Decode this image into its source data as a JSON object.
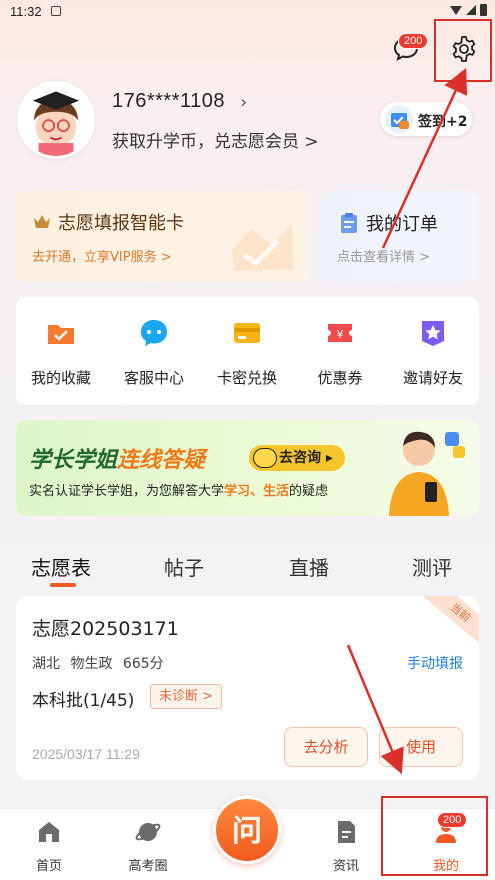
{
  "status_bar": {
    "time": "11:32"
  },
  "header": {
    "message_badge": "200"
  },
  "profile": {
    "phone": "176****1108",
    "subtitle": "获取升学币，兑志愿会员 >",
    "signin_label": "签到+2"
  },
  "cards": {
    "vip": {
      "title": "志愿填报智能卡",
      "sub": "去开通，立享VIP服务 >"
    },
    "order": {
      "title": "我的订单",
      "sub": "点击查看详情 >"
    }
  },
  "actions": [
    {
      "label": "我的收藏",
      "icon": "folder-icon",
      "color": "#f57a2e"
    },
    {
      "label": "客服中心",
      "icon": "chat-icon",
      "color": "#1aa6f0"
    },
    {
      "label": "卡密兑换",
      "icon": "card-icon",
      "color": "#f5b50e"
    },
    {
      "label": "优惠券",
      "icon": "coupon-icon",
      "color": "#f04a4a"
    },
    {
      "label": "邀请好友",
      "icon": "star-icon",
      "color": "#7b5cf0"
    }
  ],
  "banner": {
    "title_a": "学长学姐",
    "title_b": "连线答疑",
    "button": "去咨询",
    "sub_a": "实名认证学长学姐，为您解答大学",
    "sub_b": "学习、生活",
    "sub_c": "的疑虑"
  },
  "tabs": [
    "志愿表",
    "帖子",
    "直播",
    "测评"
  ],
  "wish": {
    "corner": "当前",
    "title": "志愿202503171",
    "province": "湖北",
    "subjects": "物生政",
    "score": "665分",
    "manual": "手动填报",
    "batch": "本科批(1/45)",
    "diagnosis": "未诊断 >",
    "date": "2025/03/17 11:29",
    "analyze": "去分析",
    "use": "使用"
  },
  "nav": {
    "items": [
      "首页",
      "高考圈",
      "资讯",
      "我的"
    ],
    "center": "问",
    "mine_badge": "200",
    "accent": "#f05a22"
  }
}
